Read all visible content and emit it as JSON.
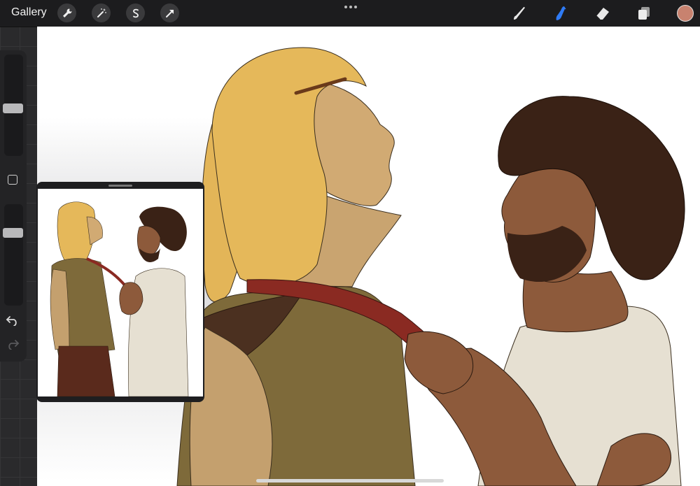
{
  "topbar": {
    "gallery_label": "Gallery",
    "left_tools": [
      "wrench-icon",
      "magic-wand-icon",
      "selection-icon",
      "transform-arrow-icon"
    ],
    "right_tools": [
      "brush-icon",
      "smudge-icon",
      "eraser-icon",
      "layers-icon"
    ],
    "active_tool": "smudge-icon",
    "current_color": "#c8826f"
  },
  "sidebar": {
    "brush_size_slider": "slider",
    "opacity_slider": "slider",
    "modify_button": "square",
    "undo": "undo-icon",
    "redo": "redo-icon"
  },
  "reference_window": {
    "title": ""
  },
  "colors": {
    "accent": "#2f7bf5",
    "hair_blond": "#e5b85a",
    "hair_dark": "#3a2216",
    "skin_light": "#c4a06e",
    "skin_dark": "#8d5a3b",
    "tunic_olive": "#7e6a3a",
    "strap_red": "#8a2a22",
    "robe": "#e6e0d2"
  }
}
